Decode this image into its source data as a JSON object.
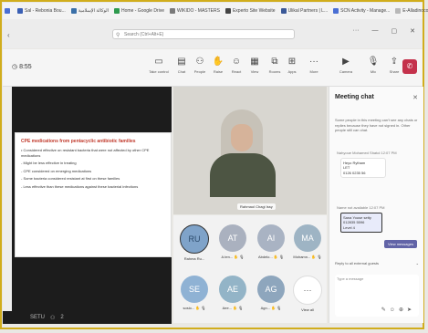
{
  "bookmarks": [
    {
      "label": "",
      "color": "#4a6fd4"
    },
    {
      "label": "Sal - Rebonia Bou...",
      "color": "#3a5fb4"
    },
    {
      "label": "الوكالة الإسلامية",
      "color": "#3a70a8"
    },
    {
      "label": "Home - Google Drive",
      "color": "#2e9a4e"
    },
    {
      "label": "WIKIDO - MASTERS",
      "color": "#7a7a7a"
    },
    {
      "label": "Experto Site Website",
      "color": "#444444"
    },
    {
      "label": "Ulikal Partners | L...",
      "color": "#3b5998"
    },
    {
      "label": "SCN Activity - Manage...",
      "color": "#4a6fd4"
    },
    {
      "label": "E-Alladinocon",
      "color": "#b8b8b8"
    }
  ],
  "search": {
    "placeholder": "Search (Ctrl+Alt+E)"
  },
  "toolbar": {
    "timer": "8:55",
    "buttons": [
      {
        "label": "Take control",
        "icon": "share-tray-icon"
      },
      {
        "label": "Chat",
        "icon": "chat-icon"
      },
      {
        "label": "People",
        "icon": "people-icon"
      },
      {
        "label": "Raise",
        "icon": "raise-hand-icon"
      },
      {
        "label": "React",
        "icon": "react-icon"
      },
      {
        "label": "View",
        "icon": "view-icon"
      },
      {
        "label": "Rooms",
        "icon": "rooms-icon"
      },
      {
        "label": "Apps",
        "icon": "apps-icon"
      },
      {
        "label": "More",
        "icon": "more-icon"
      },
      {
        "label": "Camera",
        "icon": "camera-icon"
      },
      {
        "label": "Mic",
        "icon": "mic-icon"
      },
      {
        "label": "Share",
        "icon": "share-icon"
      }
    ],
    "leave_label": "Leave"
  },
  "slide": {
    "title": "CPE medications from pentacyclic antibiotic families",
    "bullets": [
      "• Considered effective on resistant bacteria that were not affected by other CPE medications",
      "- Might be less effective in treating",
      "- CPE considered on emerging medications",
      "- Some bacteria considered resistant at first on these families",
      "- Less effective than these medications against these bacterial infections"
    ]
  },
  "bottombar": {
    "left": "SETU",
    "right": "2"
  },
  "video": {
    "caption": "Rahmaol Chagi Issy"
  },
  "participants": [
    {
      "initials": "RU",
      "name": "Rahma Ru...",
      "color": "#7fa3c9",
      "muted": false
    },
    {
      "initials": "AT",
      "name": "A.ten...",
      "color": "#aab1bf",
      "muted": true
    },
    {
      "initials": "AI",
      "name": "Abdelo...",
      "color": "#a9b3c3",
      "muted": true
    },
    {
      "initials": "MA",
      "name": "Mohamn...",
      "color": "#9eb4c4",
      "muted": true
    },
    {
      "initials": "SE",
      "name": "sosio...",
      "color": "#8fb2d4",
      "muted": true
    },
    {
      "initials": "AE",
      "name": "Aee...",
      "color": "#93b4c7",
      "muted": true
    },
    {
      "initials": "AG",
      "name": "Agn...",
      "color": "#8ea6bd",
      "muted": true
    },
    {
      "initials": "···",
      "name": "View all",
      "color": "#ffffff",
      "muted": false
    }
  ],
  "chat": {
    "title": "Meeting chat",
    "system_note": "Some people in this meeting can't see any chats or replies because they have not signed in. Other people still can chat.",
    "msg1": {
      "author": "Nahyoue Mohamed Shatol",
      "time": "12:07 PM",
      "lines": [
        "Heyo Rytham",
        "LET",
        "0126 0235 56"
      ]
    },
    "msg2": {
      "author": "Name not available",
      "time": "12:07 PM",
      "lines": [
        "Sana Youse setty",
        "012835 5596",
        "Level 4"
      ]
    },
    "view_button": "View messages",
    "reply": "Reply to all external guests",
    "compose_placeholder": "Type a message"
  }
}
